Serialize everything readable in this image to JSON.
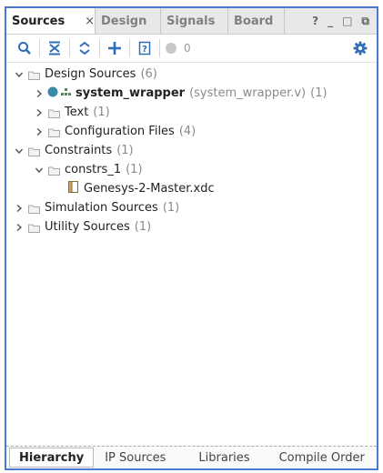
{
  "tabs": [
    {
      "label": "Sources",
      "active": true
    },
    {
      "label": "Design",
      "active": false
    },
    {
      "label": "Signals",
      "active": false
    },
    {
      "label": "Board",
      "active": false
    }
  ],
  "tab_close": "×",
  "window_controls": {
    "help": "?",
    "minimize": "_",
    "restore": "□",
    "float": "⧉"
  },
  "toolbar": {
    "count": "0"
  },
  "tree": {
    "design_sources": {
      "label": "Design Sources",
      "count": "(6)"
    },
    "system_wrapper": {
      "label": "system_wrapper",
      "file": "(system_wrapper.v)",
      "count": "(1)"
    },
    "text": {
      "label": "Text",
      "count": "(1)"
    },
    "config_files": {
      "label": "Configuration Files",
      "count": "(4)"
    },
    "constraints": {
      "label": "Constraints",
      "count": "(1)"
    },
    "constrs_1": {
      "label": "constrs_1",
      "count": "(1)"
    },
    "xdc": {
      "label": "Genesys-2-Master.xdc"
    },
    "sim_sources": {
      "label": "Simulation Sources",
      "count": "(1)"
    },
    "util_sources": {
      "label": "Utility Sources",
      "count": "(1)"
    }
  },
  "bottom_tabs": [
    {
      "label": "Hierarchy",
      "active": true
    },
    {
      "label": "IP Sources",
      "active": false
    },
    {
      "label": "Libraries",
      "active": false
    },
    {
      "label": "Compile Order",
      "active": false
    }
  ],
  "colors": {
    "accent": "#4a7bd0",
    "status_dot": "#3a8aa6",
    "toolbar_icon": "#2f6db5"
  }
}
